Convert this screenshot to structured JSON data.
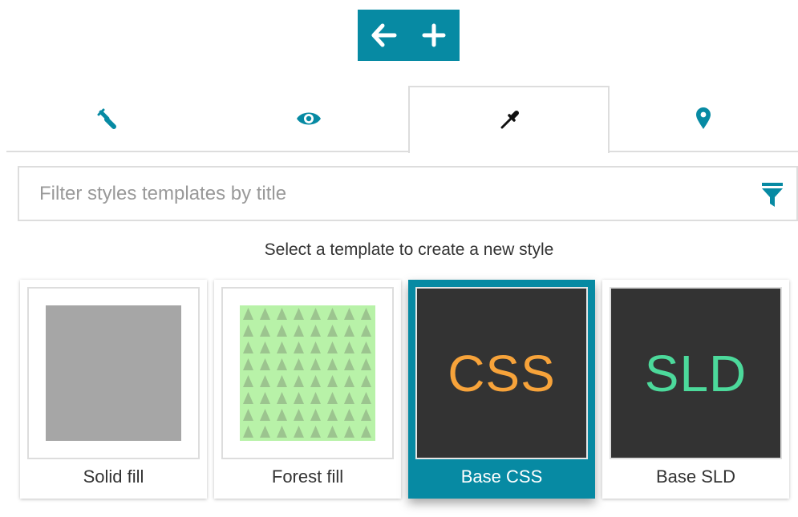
{
  "toolbar": {
    "back_icon": "arrow-left-icon",
    "add_icon": "plus-icon",
    "bg_color": "#078aa3"
  },
  "tabs": [
    {
      "icon": "wrench-icon",
      "active": false
    },
    {
      "icon": "eye-icon",
      "active": false
    },
    {
      "icon": "eyedropper-icon",
      "active": true
    },
    {
      "icon": "map-marker-icon",
      "active": false
    }
  ],
  "filter": {
    "placeholder": "Filter styles templates by title",
    "value": "",
    "icon": "funnel-icon"
  },
  "hint": "Select a template to create a new style",
  "templates": [
    {
      "label": "Solid fill",
      "selected": false
    },
    {
      "label": "Forest fill",
      "selected": false
    },
    {
      "label": "Base CSS",
      "thumb_text": "CSS",
      "thumb_color": "#f7a33a",
      "selected": true
    },
    {
      "label": "Base SLD",
      "thumb_text": "SLD",
      "thumb_color": "#4cd99b",
      "selected": false
    }
  ],
  "colors": {
    "accent": "#078aa3",
    "thumb_dark": "#333333",
    "forest_bg": "#b8f2a8",
    "forest_tree": "#9cc48f"
  }
}
